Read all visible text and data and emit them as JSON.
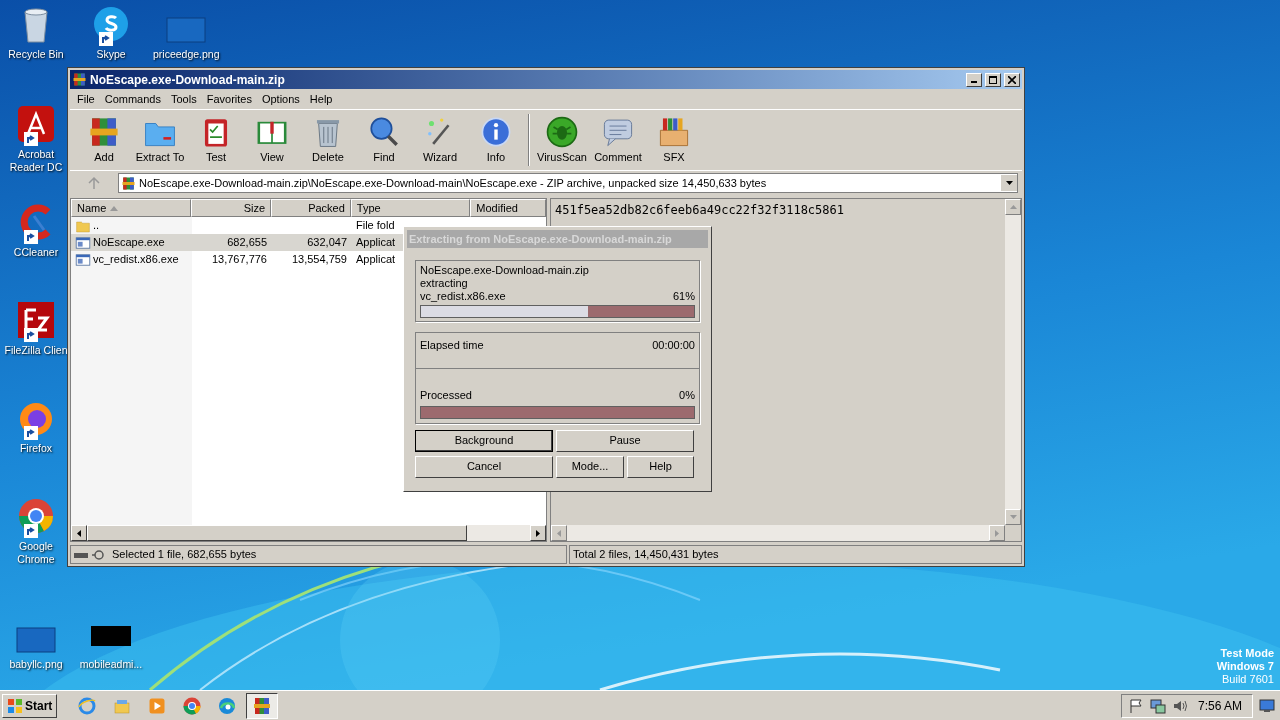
{
  "desktop_icons": [
    {
      "label": "Recycle Bin",
      "kind": "recycle",
      "shortcut": false
    },
    {
      "label": "Skype",
      "kind": "skype",
      "shortcut": true
    },
    {
      "label": "priceedge.png",
      "kind": "blank",
      "shortcut": false
    },
    {
      "label": "Acrobat Reader DC",
      "kind": "pdf",
      "shortcut": true
    },
    {
      "label": "CCleaner",
      "kind": "ccleaner",
      "shortcut": true
    },
    {
      "label": "FileZilla Clien",
      "kind": "filezilla",
      "shortcut": true
    },
    {
      "label": "Firefox",
      "kind": "firefox",
      "shortcut": true
    },
    {
      "label": "Google Chrome",
      "kind": "chrome",
      "shortcut": true
    },
    {
      "label": "babyllc.png",
      "kind": "blank",
      "shortcut": false
    },
    {
      "label": "mobileadmi...",
      "kind": "black",
      "shortcut": false
    }
  ],
  "window": {
    "title": "NoEscape.exe-Download-main.zip",
    "menu": [
      "File",
      "Commands",
      "Tools",
      "Favorites",
      "Options",
      "Help"
    ],
    "toolbar_groups": [
      {
        "buttons": [
          {
            "label": "Add",
            "kind": "add"
          },
          {
            "label": "Extract To",
            "kind": "extract"
          },
          {
            "label": "Test",
            "kind": "test"
          },
          {
            "label": "View",
            "kind": "view"
          },
          {
            "label": "Delete",
            "kind": "delete"
          },
          {
            "label": "Find",
            "kind": "find"
          },
          {
            "label": "Wizard",
            "kind": "wizard"
          },
          {
            "label": "Info",
            "kind": "info"
          }
        ]
      },
      {
        "buttons": [
          {
            "label": "VirusScan",
            "kind": "virus"
          },
          {
            "label": "Comment",
            "kind": "comment"
          },
          {
            "label": "SFX",
            "kind": "sfx"
          }
        ]
      }
    ],
    "address": "NoEscape.exe-Download-main.zip\\NoEscape.exe-Download-main\\NoEscape.exe - ZIP archive, unpacked size 14,450,633 bytes",
    "columns": [
      "Name",
      "Size",
      "Packed",
      "Type",
      "Modified"
    ],
    "rows": [
      {
        "kind": "folder",
        "name": "..",
        "size": "",
        "packed": "",
        "type": "File fold",
        "selected": false
      },
      {
        "kind": "exe",
        "name": "NoEscape.exe",
        "size": "682,655",
        "packed": "632,047",
        "type": "Applicat",
        "selected": true
      },
      {
        "kind": "exe",
        "name": "vc_redist.x86.exe",
        "size": "13,767,776",
        "packed": "13,554,759",
        "type": "Applicat",
        "selected": false
      }
    ],
    "comment": "451f5ea52db82c6feeb6a49cc22f32f3118c5861",
    "status_left": "Selected 1 file, 682,655 bytes",
    "status_right": "Total 2 files, 14,450,431 bytes"
  },
  "dialog": {
    "title": "Extracting from NoEscape.exe-Download-main.zip",
    "archive": "NoEscape.exe-Download-main.zip",
    "action": "extracting",
    "current": {
      "file": "vc_redist.x86.exe",
      "percent": "61%",
      "level": 0.61
    },
    "elapsed_label": "Elapsed time",
    "elapsed": "00:00:00",
    "total": {
      "label": "Processed",
      "percent": "0%",
      "level": 0
    },
    "buttons": [
      {
        "label": "Background",
        "focused": true
      },
      {
        "label": "Pause",
        "focused": false
      },
      {
        "label": "Cancel",
        "focused": false
      },
      {
        "label": "Mode...",
        "focused": false
      },
      {
        "label": "Help",
        "focused": false
      }
    ]
  },
  "system_notice": [
    "Test Mode",
    "Windows 7",
    "Build 7601"
  ],
  "taskbar": {
    "start": "Start",
    "apps": [
      {
        "kind": "ie",
        "active": false
      },
      {
        "kind": "explorer",
        "active": false
      },
      {
        "kind": "media",
        "active": false
      },
      {
        "kind": "chrome",
        "active": false
      },
      {
        "kind": "edge",
        "active": false
      },
      {
        "kind": "winrar",
        "active": true
      }
    ],
    "clock": "7:56 AM"
  }
}
